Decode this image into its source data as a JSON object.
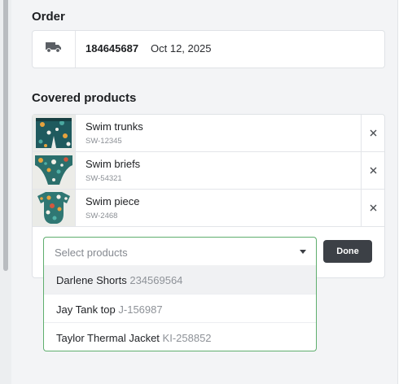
{
  "order": {
    "heading": "Order",
    "icon": "truck-icon",
    "number": "184645687",
    "date": "Oct 12, 2025"
  },
  "covered_products": {
    "heading": "Covered products",
    "items": [
      {
        "name": "Swim trunks",
        "sku": "SW-12345",
        "remove_icon": "close-icon"
      },
      {
        "name": "Swim briefs",
        "sku": "SW-54321",
        "remove_icon": "close-icon"
      },
      {
        "name": "Swim piece",
        "sku": "SW-2468",
        "remove_icon": "close-icon"
      }
    ]
  },
  "selector": {
    "placeholder": "Select products",
    "done_label": "Done",
    "options": [
      {
        "name": "Darlene Shorts",
        "sku": "234569564"
      },
      {
        "name": "Jay Tank top",
        "sku": "J-156987"
      },
      {
        "name": "Taylor Thermal Jacket",
        "sku": "KI-258852"
      }
    ]
  },
  "colors": {
    "accent_border": "#5fae6e",
    "button_bg": "#3c4046",
    "panel_bg": "#f3f4f6"
  }
}
